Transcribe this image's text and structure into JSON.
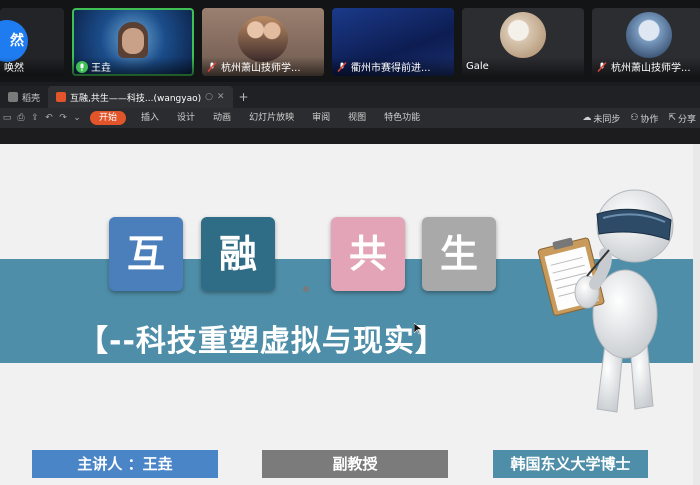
{
  "participants": [
    {
      "name": "唤然",
      "initials": "然",
      "mic": "on"
    },
    {
      "name": "王垚",
      "mic": "on",
      "active": true
    },
    {
      "name": "杭州萧山技师学...",
      "mic": "muted"
    },
    {
      "name": "衢州市赛得前进...",
      "mic": "muted"
    },
    {
      "name": "Gale",
      "mic": "none"
    },
    {
      "name": "杭州萧山技师学...",
      "mic": "muted"
    }
  ],
  "tabs": [
    {
      "label": "稻壳",
      "icon_color": "#7a7a7a"
    },
    {
      "label": "互融,共生——科技...(wangyao)",
      "icon_color": "#e2552b",
      "active": true
    }
  ],
  "menu": [
    "开始",
    "插入",
    "设计",
    "动画",
    "幻灯片放映",
    "审阅",
    "视图",
    "特色功能"
  ],
  "menu_active_index": 0,
  "toolbar_right": {
    "sync": "未同步",
    "collab": "协作",
    "share": "分享"
  },
  "slide": {
    "chars": [
      "互",
      "融",
      "共",
      "生"
    ],
    "subtitle": "【--科技重塑虚拟与现实】",
    "speaker": "主讲人 ：王垚",
    "position": "副教授",
    "degree": "韩国东义大学博士"
  },
  "colors": {
    "accent": "#e2552b",
    "band": "#4f8ea8",
    "active_speaker": "#3fbf54"
  }
}
